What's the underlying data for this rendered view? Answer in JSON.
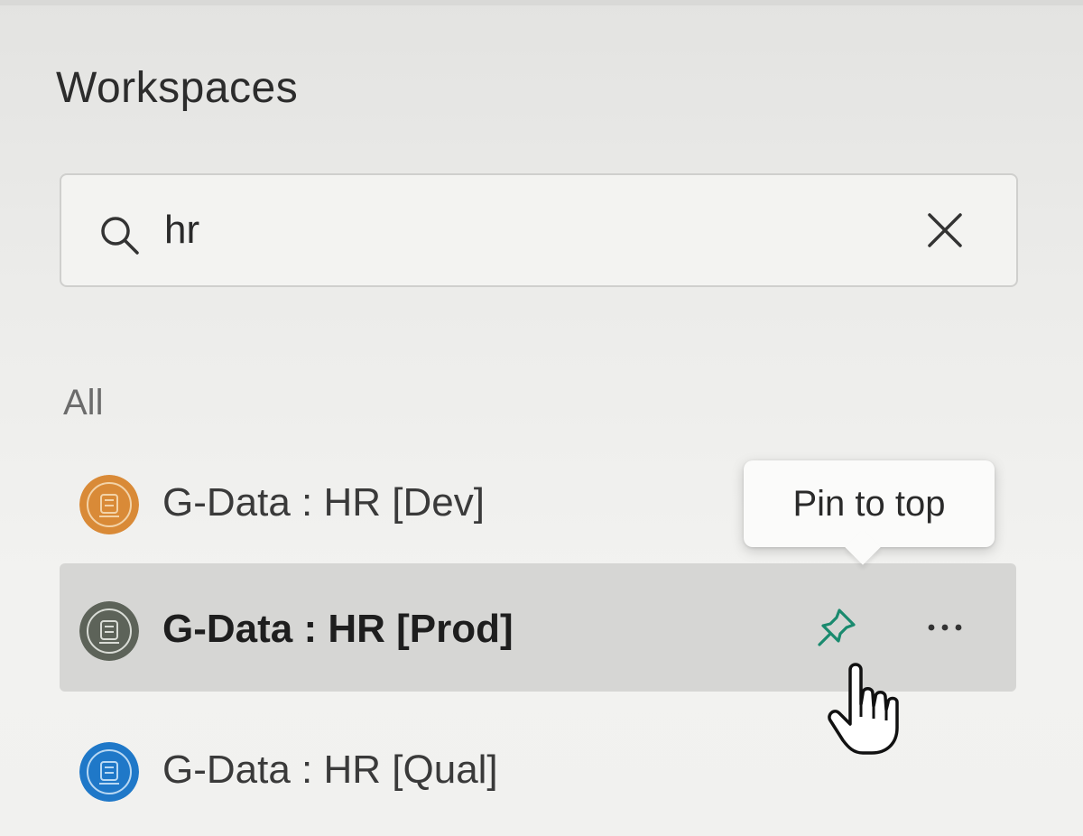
{
  "panel": {
    "title": "Workspaces"
  },
  "search": {
    "value": "hr",
    "icon": "search-icon",
    "clear_icon": "close-icon"
  },
  "section": {
    "label": "All"
  },
  "workspaces": [
    {
      "name": "G-Data : HR [Dev]",
      "avatar_color": "#d98a37",
      "state": "normal"
    },
    {
      "name": "G-Data : HR [Prod]",
      "avatar_color": "#5d6359",
      "state": "hovered"
    },
    {
      "name": "G-Data : HR [Qual]",
      "avatar_color": "#1f78c8",
      "state": "normal"
    }
  ],
  "row_actions": {
    "pin_icon": "pin-icon",
    "more_icon": "more-horizontal-icon"
  },
  "tooltip": {
    "text": "Pin to top"
  },
  "colors": {
    "accent_pin": "#1a8a6e",
    "hover_bg": "#d6d6d4"
  }
}
